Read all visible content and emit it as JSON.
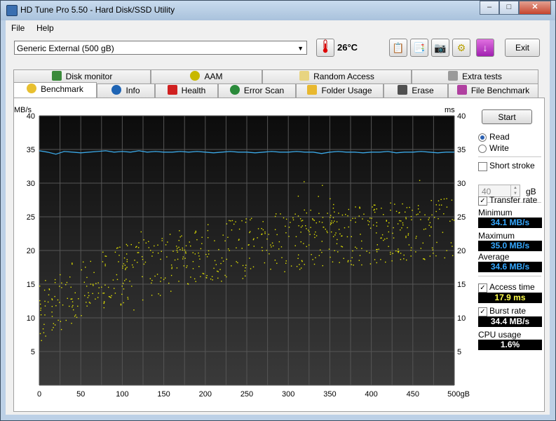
{
  "window": {
    "title": "HD Tune Pro 5.50 - Hard Disk/SSD Utility"
  },
  "menu": {
    "file": "File",
    "help": "Help"
  },
  "toolbar": {
    "drive": "Generic External (500 gB)",
    "temperature": "26°C",
    "exit_label": "Exit"
  },
  "tabs_top": [
    {
      "label": "Disk monitor",
      "icon": "bar-chart-icon"
    },
    {
      "label": "AAM",
      "icon": "speaker-icon"
    },
    {
      "label": "Random Access",
      "icon": "dots-grid-icon"
    },
    {
      "label": "Extra tests",
      "icon": "table-icon"
    }
  ],
  "tabs_bottom": [
    {
      "label": "Benchmark",
      "icon": "bulb-icon"
    },
    {
      "label": "Info",
      "icon": "info-icon"
    },
    {
      "label": "Health",
      "icon": "plus-icon"
    },
    {
      "label": "Error Scan",
      "icon": "magnifier-icon"
    },
    {
      "label": "Folder Usage",
      "icon": "folder-icon"
    },
    {
      "label": "Erase",
      "icon": "trash-icon"
    },
    {
      "label": "File Benchmark",
      "icon": "file-icon"
    }
  ],
  "side": {
    "start_label": "Start",
    "read_label": "Read",
    "write_label": "Write",
    "short_stroke_label": "Short stroke",
    "short_stroke_value": "40",
    "short_stroke_unit": "gB",
    "transfer_rate_label": "Transfer rate",
    "minimum_label": "Minimum",
    "minimum_value": "34.1 MB/s",
    "maximum_label": "Maximum",
    "maximum_value": "35.0 MB/s",
    "average_label": "Average",
    "average_value": "34.6 MB/s",
    "access_time_label": "Access time",
    "access_time_value": "17.9 ms",
    "burst_rate_label": "Burst rate",
    "burst_rate_value": "34.4 MB/s",
    "cpu_label": "CPU usage",
    "cpu_value": "1.6%"
  },
  "chart_data": {
    "type": "line",
    "y_left_label": "MB/s",
    "y_right_label": "ms",
    "x_unit": "gB",
    "xlim": [
      0,
      500
    ],
    "ylim": [
      0,
      40
    ],
    "x_ticks": [
      "0",
      "50",
      "100",
      "150",
      "200",
      "250",
      "300",
      "350",
      "400",
      "450",
      "500gB"
    ],
    "y_ticks": [
      "5",
      "10",
      "15",
      "20",
      "25",
      "30",
      "35",
      "40"
    ],
    "grid": true,
    "colors": {
      "background": "#111111",
      "transfer": "#3ba8e6",
      "access": "#e6e600",
      "grid": "#555555"
    },
    "series": [
      {
        "kind": "line",
        "x": [
          0,
          10,
          20,
          30,
          40,
          50,
          60,
          70,
          80,
          90,
          100,
          110,
          120,
          130,
          140,
          150,
          160,
          170,
          180,
          190,
          200,
          210,
          220,
          230,
          240,
          250,
          260,
          270,
          280,
          290,
          300,
          310,
          320,
          330,
          340,
          350,
          360,
          370,
          380,
          390,
          400,
          410,
          420,
          430,
          440,
          450,
          460,
          470,
          480,
          490,
          500
        ],
        "y": [
          34.8,
          34.6,
          34.3,
          34.7,
          34.6,
          34.5,
          34.6,
          34.7,
          34.8,
          34.6,
          34.7,
          34.6,
          34.8,
          34.6,
          34.7,
          34.6,
          34.6,
          34.7,
          34.6,
          34.7,
          34.6,
          34.5,
          34.6,
          34.7,
          34.6,
          34.6,
          34.5,
          34.6,
          34.7,
          34.6,
          34.6,
          34.7,
          34.6,
          34.6,
          34.4,
          34.6,
          34.7,
          34.6,
          34.6,
          34.5,
          34.6,
          34.6,
          34.7,
          34.5,
          34.6,
          34.6,
          34.7,
          34.6,
          34.5,
          34.6,
          34.6
        ]
      },
      {
        "kind": "scatter",
        "trend_x": [
          0,
          50,
          100,
          150,
          200,
          250,
          300,
          350,
          400,
          450,
          500
        ],
        "trend_y": [
          11,
          14.5,
          16.5,
          18,
          19.5,
          20.5,
          21.5,
          22,
          22.5,
          23,
          23.5
        ],
        "spread": 4.5,
        "count": 650
      }
    ]
  }
}
